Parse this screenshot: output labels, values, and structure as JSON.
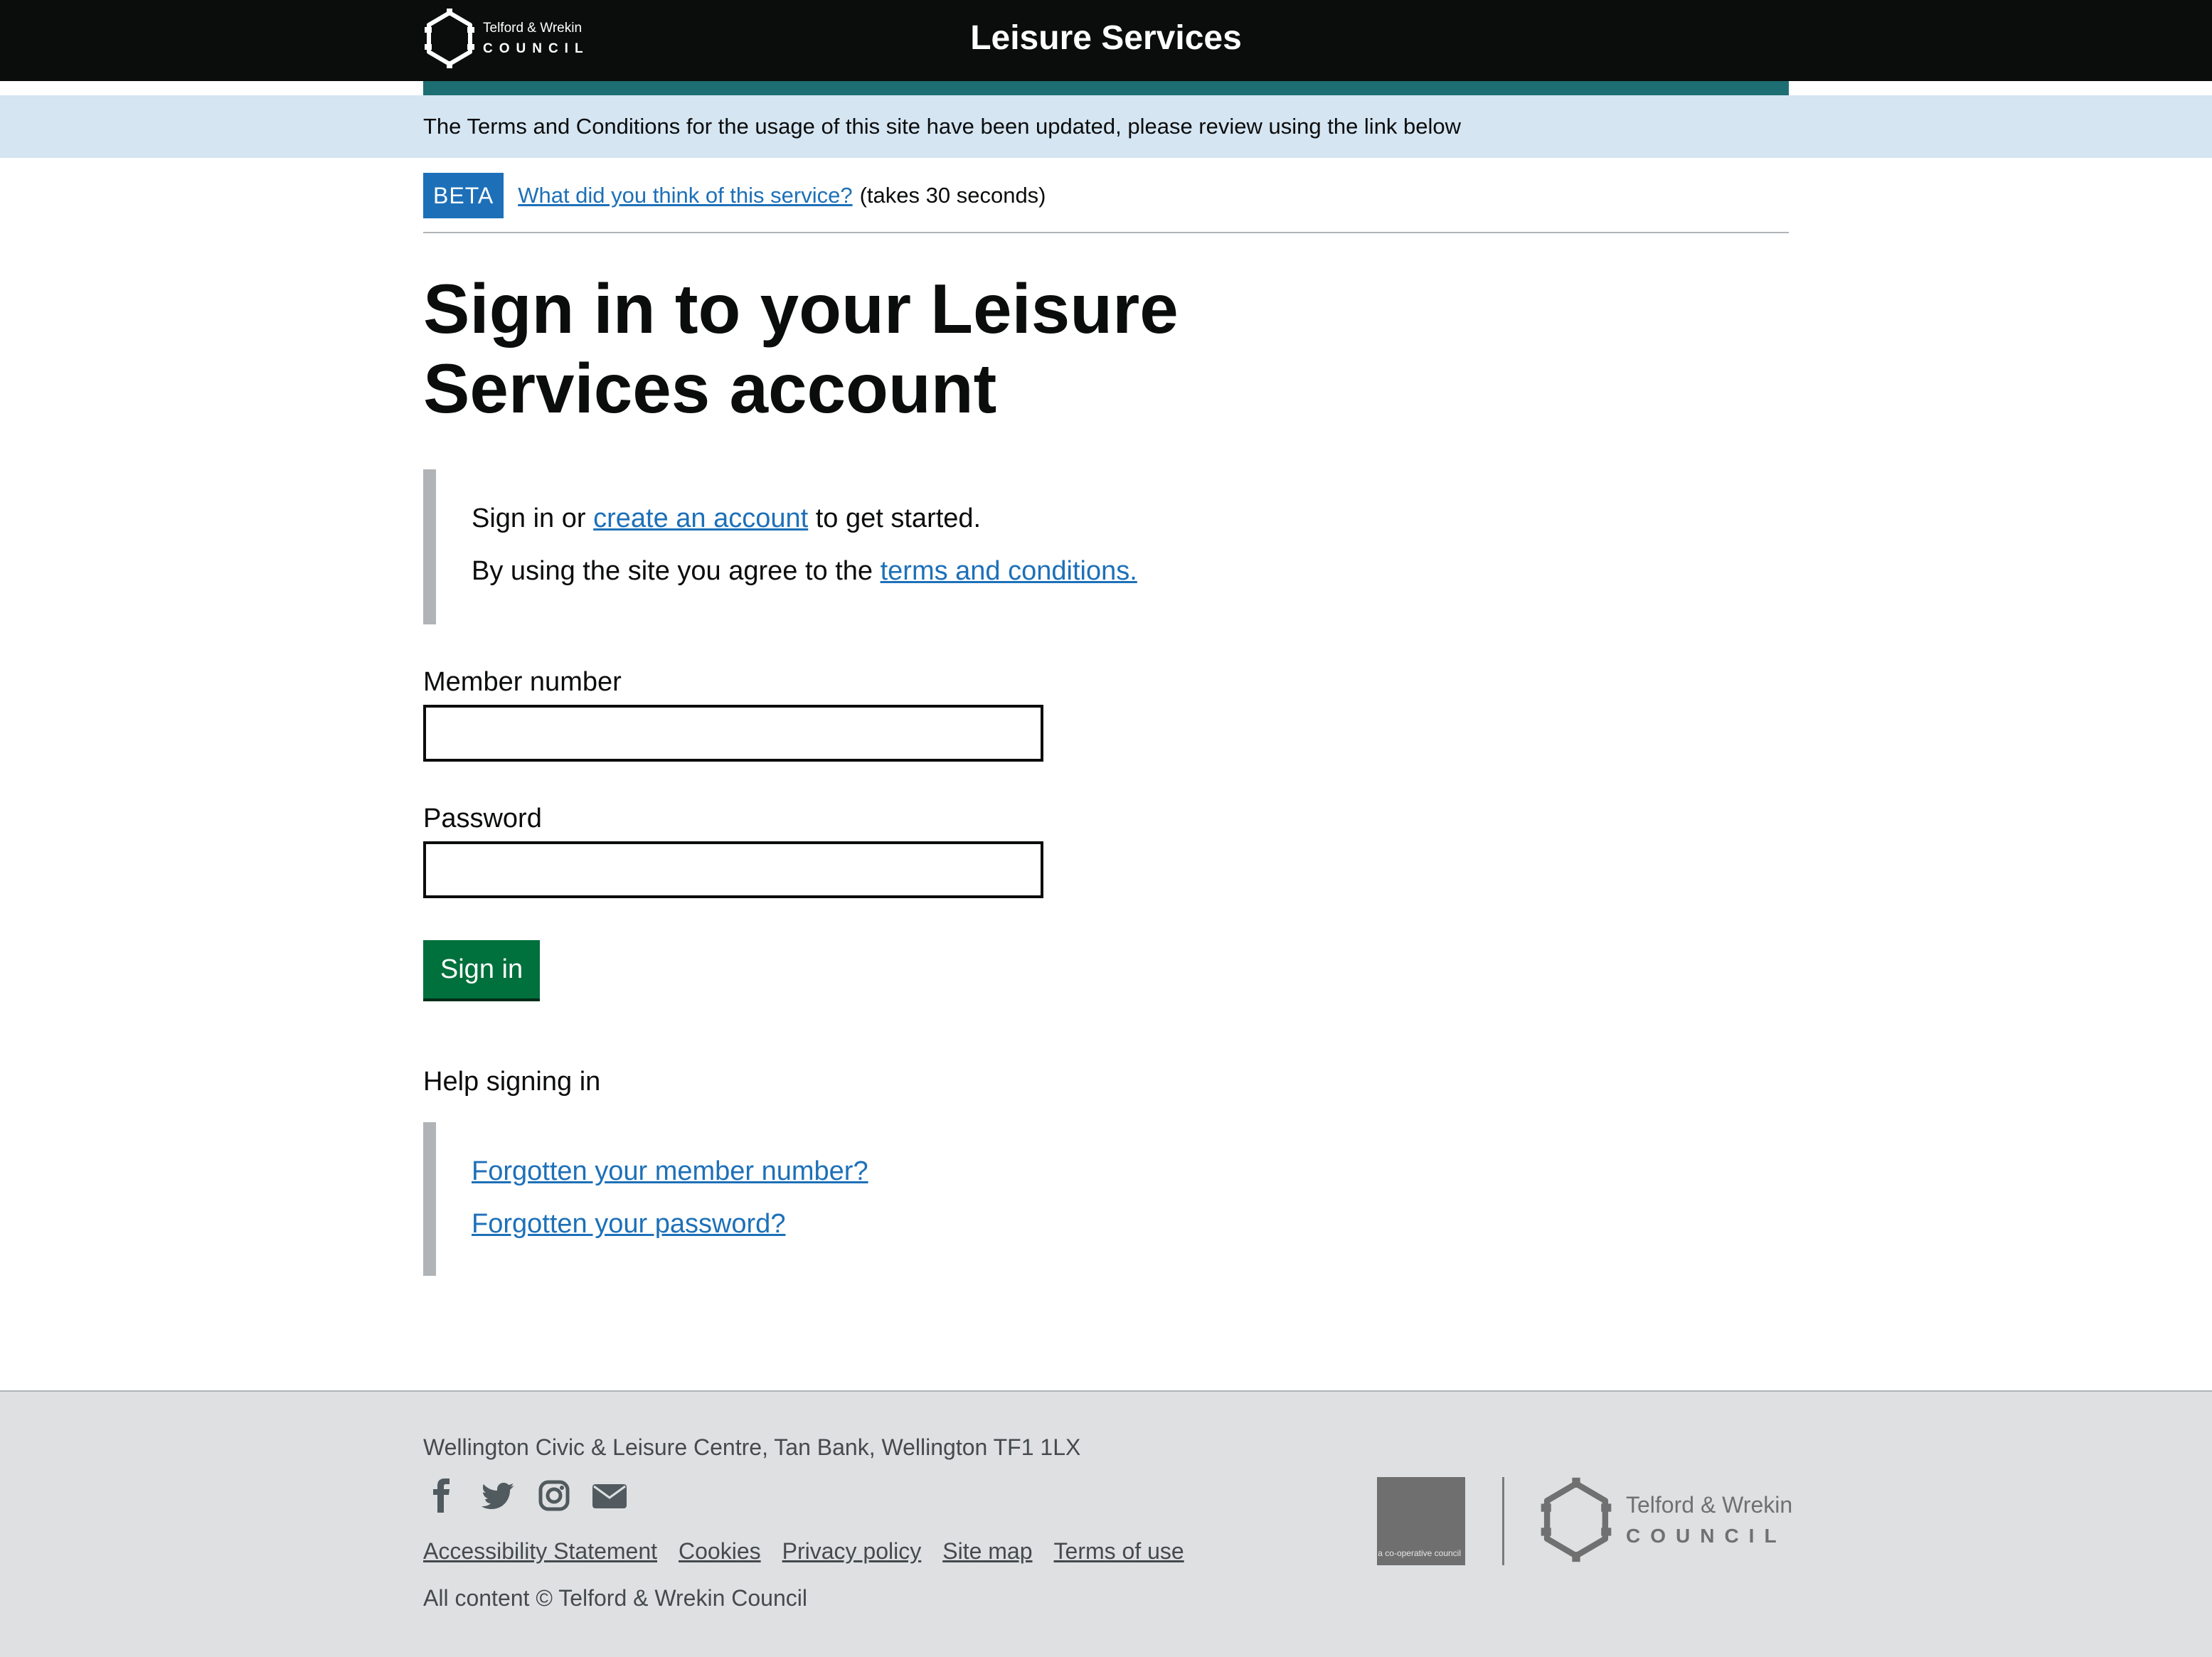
{
  "header": {
    "logo_line1": "Telford & Wrekin",
    "logo_line2": "COUNCIL",
    "site_title": "Leisure Services"
  },
  "notice": {
    "text": "The Terms and Conditions for the usage of this site have been updated, please review using the link below"
  },
  "beta": {
    "tag": "BETA",
    "feedback_link": "What did you think of this service?",
    "note": "(takes 30 seconds)"
  },
  "main": {
    "title": "Sign in to your Leisure Services account",
    "intro": {
      "prefix": "Sign in or ",
      "create_link": "create an account",
      "suffix": " to get started.",
      "terms_prefix": "By using the site you agree to the ",
      "terms_link": "terms and conditions."
    },
    "form": {
      "member_label": "Member number",
      "member_value": "",
      "password_label": "Password",
      "password_value": "",
      "submit_label": "Sign in"
    },
    "help": {
      "title": "Help signing in",
      "forgot_member": "Forgotten your member number?",
      "forgot_password": "Forgotten your password?"
    }
  },
  "footer": {
    "address": "Wellington Civic & Leisure Centre, Tan Bank, Wellington TF1 1LX",
    "social_icons": [
      "facebook-icon",
      "twitter-icon",
      "instagram-icon",
      "email-icon"
    ],
    "links": [
      "Accessibility Statement",
      "Cookies",
      "Privacy policy",
      "Site map",
      "Terms of use"
    ],
    "copyright": "All content © Telford & Wrekin Council",
    "coop_text": "a co-operative council",
    "logo_line1": "Telford & Wrekin",
    "logo_line2": "COUNCIL"
  },
  "colors": {
    "header_bg": "#0b0c0c",
    "teal_bar": "#1d6e72",
    "notice_bg": "#d5e5f2",
    "link": "#1d70b8",
    "button": "#00703c",
    "footer_bg": "#dee0e2"
  }
}
